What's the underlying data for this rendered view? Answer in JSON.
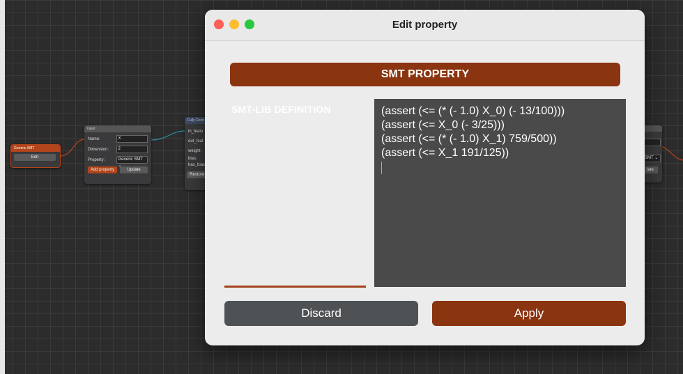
{
  "background": {
    "generic_node": {
      "title": "Generic SMT",
      "edit_label": "Edit"
    },
    "input_node": {
      "title": "Input",
      "name_label": "Name:",
      "name_value": "X",
      "dimension_label": "Dimension:",
      "dimension_value": "2",
      "property_label": "Property:",
      "property_value": "Generic SMT",
      "add_property_label": "Add property",
      "update_label": "Update"
    },
    "fc_node": {
      "title": "Fully Conn",
      "fields": [
        "in_featu",
        "out_feat",
        "weight:",
        "bias:",
        "has_bias"
      ],
      "restore_label": "Restore c"
    },
    "right_node": {
      "select_value": "SMT",
      "button_label": "late"
    }
  },
  "dialog": {
    "title": "Edit property",
    "header": "SMT PROPERTY",
    "definition_label": "SMT-LIB DEFINITION",
    "code_lines": [
      "(assert (<= (* (- 1.0) X_0) (- 13/100)))",
      "(assert (<= X_0 (- 3/25)))",
      "(assert (<= (* (- 1.0) X_1) 759/500))",
      "(assert (<= X_1 191/125))"
    ],
    "discard_label": "Discard",
    "apply_label": "Apply"
  },
  "colors": {
    "accent": "#8a3410",
    "dialog_bg": "#ececec",
    "code_bg": "#4a4a4a",
    "discard_bg": "#4f5255",
    "canvas_bg": "#2c2c2c"
  },
  "icons": [
    "close-traffic-light",
    "minimize-traffic-light",
    "maximize-traffic-light",
    "dropdown-chevron-icon"
  ]
}
